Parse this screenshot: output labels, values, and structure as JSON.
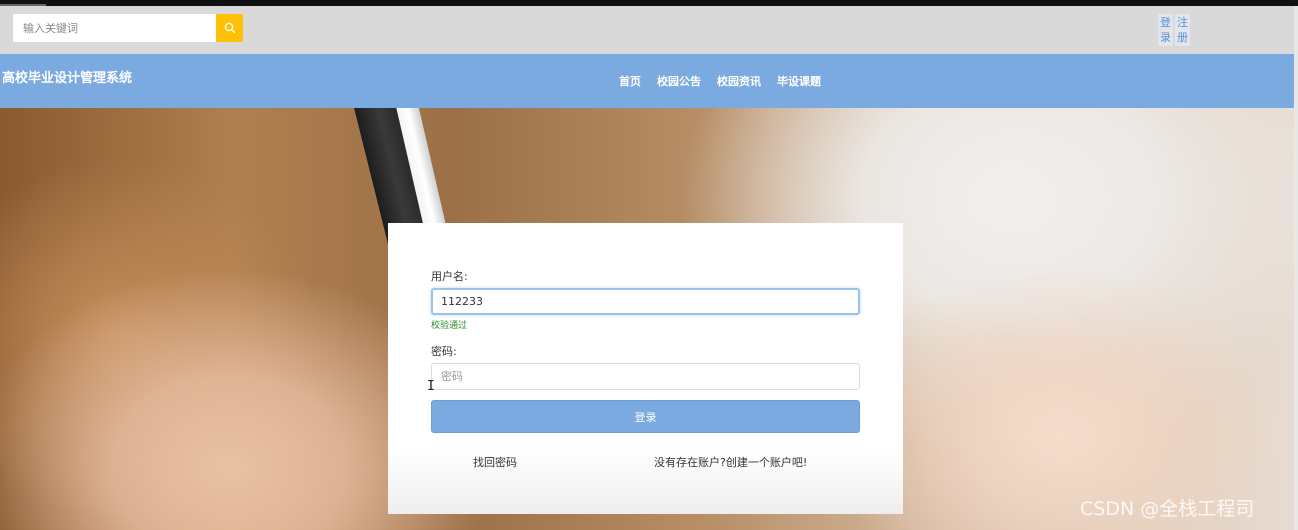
{
  "header": {
    "search": {
      "placeholder": "输入关键词",
      "value": ""
    },
    "auth": {
      "login": "登录",
      "login_l1": "登",
      "login_l2": "录",
      "register": "注册",
      "register_l1": "注",
      "register_l2": "册"
    }
  },
  "nav": {
    "site_title": "高校毕业设计管理系统",
    "items": [
      {
        "label": "首页"
      },
      {
        "label": "校园公告"
      },
      {
        "label": "校园资讯"
      },
      {
        "label": "毕设课题"
      }
    ]
  },
  "login_form": {
    "username_label": "用户名:",
    "username_value": "112233",
    "validation_msg": "校验通过",
    "password_label": "密码:",
    "password_placeholder": "密码",
    "submit_label": "登录",
    "forgot_link": "找回密码",
    "register_link": "没有存在账户?创建一个账户吧!"
  },
  "watermark": "CSDN @全栈工程司",
  "colors": {
    "accent": "#7baae0",
    "search_button": "#ffc107",
    "valid": "#2e8b2e"
  },
  "icons": {
    "search_button": "search-icon"
  }
}
